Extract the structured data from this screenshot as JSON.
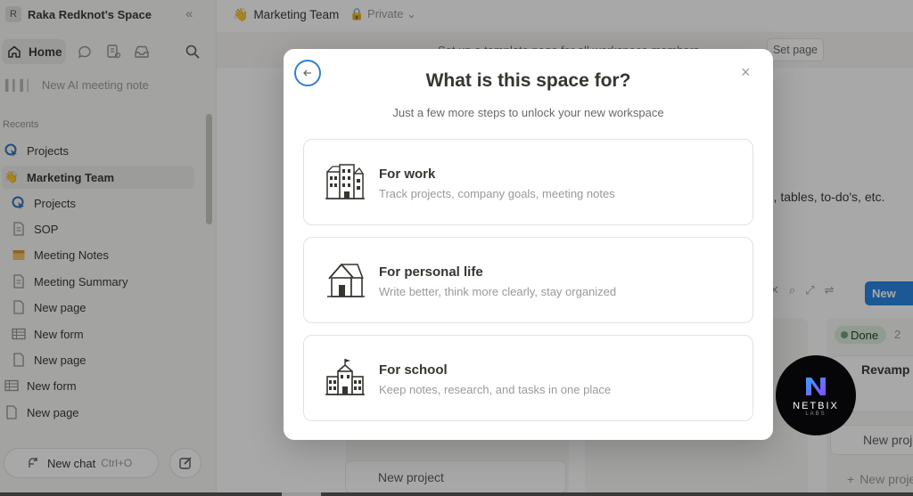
{
  "sidebar": {
    "workspace_initial": "R",
    "workspace_name": "Raka Redknot's Space",
    "home_label": "Home",
    "ai_note_label": "New AI meeting note",
    "recents_label": "Recents",
    "items": [
      {
        "label": "Projects",
        "icon": "projects-icon"
      },
      {
        "label": "Marketing Team",
        "icon": "hand-emoji-icon"
      },
      {
        "label": "Projects",
        "icon": "projects-icon"
      },
      {
        "label": "SOP",
        "icon": "page-icon"
      },
      {
        "label": "Meeting Notes",
        "icon": "calendar-icon"
      },
      {
        "label": "Meeting Summary",
        "icon": "page-icon"
      },
      {
        "label": "New page",
        "icon": "page-icon"
      },
      {
        "label": "New form",
        "icon": "form-icon"
      },
      {
        "label": "New page",
        "icon": "page-icon"
      },
      {
        "label": "New form",
        "icon": "form-icon"
      },
      {
        "label": "New page",
        "icon": "page-icon"
      }
    ],
    "new_chat_label": "New chat",
    "new_chat_shortcut": "Ctrl+O"
  },
  "topbar": {
    "emoji": "👋",
    "title": "Marketing Team",
    "privacy": "Private"
  },
  "banner": {
    "text": "Set up a template page for all workspace members",
    "button": "Set page"
  },
  "background": {
    "content_text": "lers, tables, to-do's, etc.",
    "new_button": "New",
    "done_label": "Done",
    "done_count": "2",
    "card_title": "Revamp",
    "new_project": "New project"
  },
  "modal": {
    "title": "What is this space for?",
    "subtitle": "Just a few more steps to unlock your new workspace",
    "options": [
      {
        "title": "For work",
        "description": "Track projects, company goals, meeting notes"
      },
      {
        "title": "For personal life",
        "description": "Write better, think more clearly, stay organized"
      },
      {
        "title": "For school",
        "description": "Keep notes, research, and tasks in one place"
      }
    ]
  },
  "watermark": {
    "name": "NETBIX",
    "sub": "LABS"
  },
  "colors": {
    "accent": "#2383e2",
    "back_ring": "#2f80d6",
    "overlay": "rgba(15,15,15,0.36)"
  }
}
